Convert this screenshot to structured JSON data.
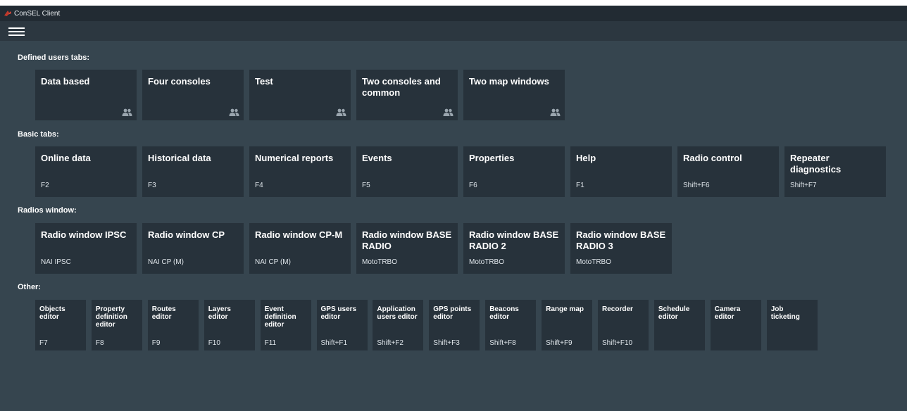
{
  "window": {
    "title": "ConSEL Client"
  },
  "sections": {
    "defined": "Defined users tabs:",
    "basic": "Basic tabs:",
    "radios": "Radios window:",
    "other": "Other:"
  },
  "defined_tabs": [
    {
      "name": "Data based"
    },
    {
      "name": "Four consoles"
    },
    {
      "name": "Test"
    },
    {
      "name": "Two consoles and common"
    },
    {
      "name": "Two map windows"
    }
  ],
  "basic_tabs": [
    {
      "name": "Online data",
      "key": "F2"
    },
    {
      "name": "Historical data",
      "key": "F3"
    },
    {
      "name": "Numerical reports",
      "key": "F4"
    },
    {
      "name": "Events",
      "key": "F5"
    },
    {
      "name": "Properties",
      "key": "F6"
    },
    {
      "name": "Help",
      "key": "F1"
    },
    {
      "name": "Radio control",
      "key": "Shift+F6"
    },
    {
      "name": "Repeater diagnostics",
      "key": "Shift+F7"
    }
  ],
  "radio_windows": [
    {
      "name": "Radio window IPSC",
      "sub": "NAI IPSC"
    },
    {
      "name": "Radio window CP",
      "sub": "NAI CP (M)"
    },
    {
      "name": "Radio window CP-M",
      "sub": "NAI CP (M)"
    },
    {
      "name": "Radio window BASE RADIO",
      "sub": "MotoTRBO"
    },
    {
      "name": "Radio window BASE RADIO 2",
      "sub": "MotoTRBO"
    },
    {
      "name": "Radio window BASE RADIO 3",
      "sub": "MotoTRBO"
    }
  ],
  "other_tabs": [
    {
      "name": "Objects editor",
      "key": "F7"
    },
    {
      "name": "Property definition editor",
      "key": "F8"
    },
    {
      "name": "Routes editor",
      "key": "F9"
    },
    {
      "name": "Layers editor",
      "key": "F10"
    },
    {
      "name": "Event definition editor",
      "key": "F11"
    },
    {
      "name": "GPS users editor",
      "key": "Shift+F1"
    },
    {
      "name": "Application users editor",
      "key": "Shift+F2"
    },
    {
      "name": "GPS points editor",
      "key": "Shift+F3"
    },
    {
      "name": "Beacons editor",
      "key": "Shift+F8"
    },
    {
      "name": "Range map",
      "key": "Shift+F9"
    },
    {
      "name": "Recorder",
      "key": "Shift+F10"
    },
    {
      "name": "Schedule editor",
      "key": ""
    },
    {
      "name": "Camera editor",
      "key": ""
    },
    {
      "name": "Job ticketing",
      "key": ""
    }
  ],
  "icons": {
    "app": "consel-logo-icon",
    "menu": "hamburger-menu-icon",
    "users": "users-icon"
  },
  "colors": {
    "background": "#36454f",
    "tile": "#27323b",
    "titlebar": "#222b33",
    "menubar": "#2c3740"
  }
}
